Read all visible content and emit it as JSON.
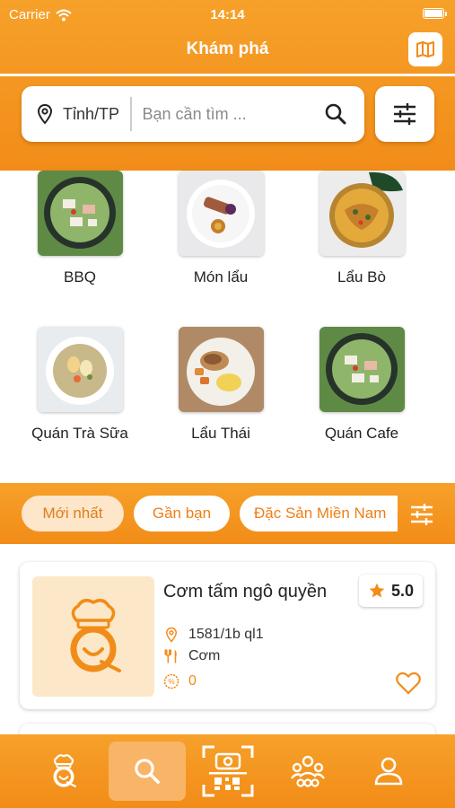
{
  "status_bar": {
    "carrier": "Carrier",
    "time": "14:14"
  },
  "header": {
    "title": "Khám phá",
    "map_icon": "map-icon"
  },
  "search": {
    "city": "Tỉnh/TP",
    "placeholder": "Bạn cần tìm ..."
  },
  "categories": [
    {
      "label": "BBQ",
      "image": "salad-bowl-green"
    },
    {
      "label": "Món lẩu",
      "image": "plated-dish"
    },
    {
      "label": "Lẩu Bò",
      "image": "noodle-bowl"
    },
    {
      "label": "Quán Trà Sữa",
      "image": "egg-salad-plate"
    },
    {
      "label": "Lẩu Thái",
      "image": "chicken-potato-plate"
    },
    {
      "label": "Quán Cafe",
      "image": "salad-bowl-green"
    }
  ],
  "filter_tabs": [
    {
      "label": "Mới nhất",
      "active": true
    },
    {
      "label": "Gần bạn",
      "active": false
    },
    {
      "label": "Đặc Sản Miền Nam",
      "active": false
    }
  ],
  "restaurants": [
    {
      "name": "Cơm tấm ngô quyền",
      "rating": "5.0",
      "address": "1581/1b ql1",
      "category": "Cơm",
      "discount": "0"
    }
  ],
  "bottom_nav": [
    {
      "icon": "chef-logo-icon",
      "active": false
    },
    {
      "icon": "search-icon",
      "active": true
    },
    {
      "icon": "qr-scan-icon",
      "active": false
    },
    {
      "icon": "community-icon",
      "active": false
    },
    {
      "icon": "profile-icon",
      "active": false
    }
  ],
  "colors": {
    "primary": "#F28C18",
    "accent_light": "#FDE6C9",
    "white": "#ffffff"
  }
}
